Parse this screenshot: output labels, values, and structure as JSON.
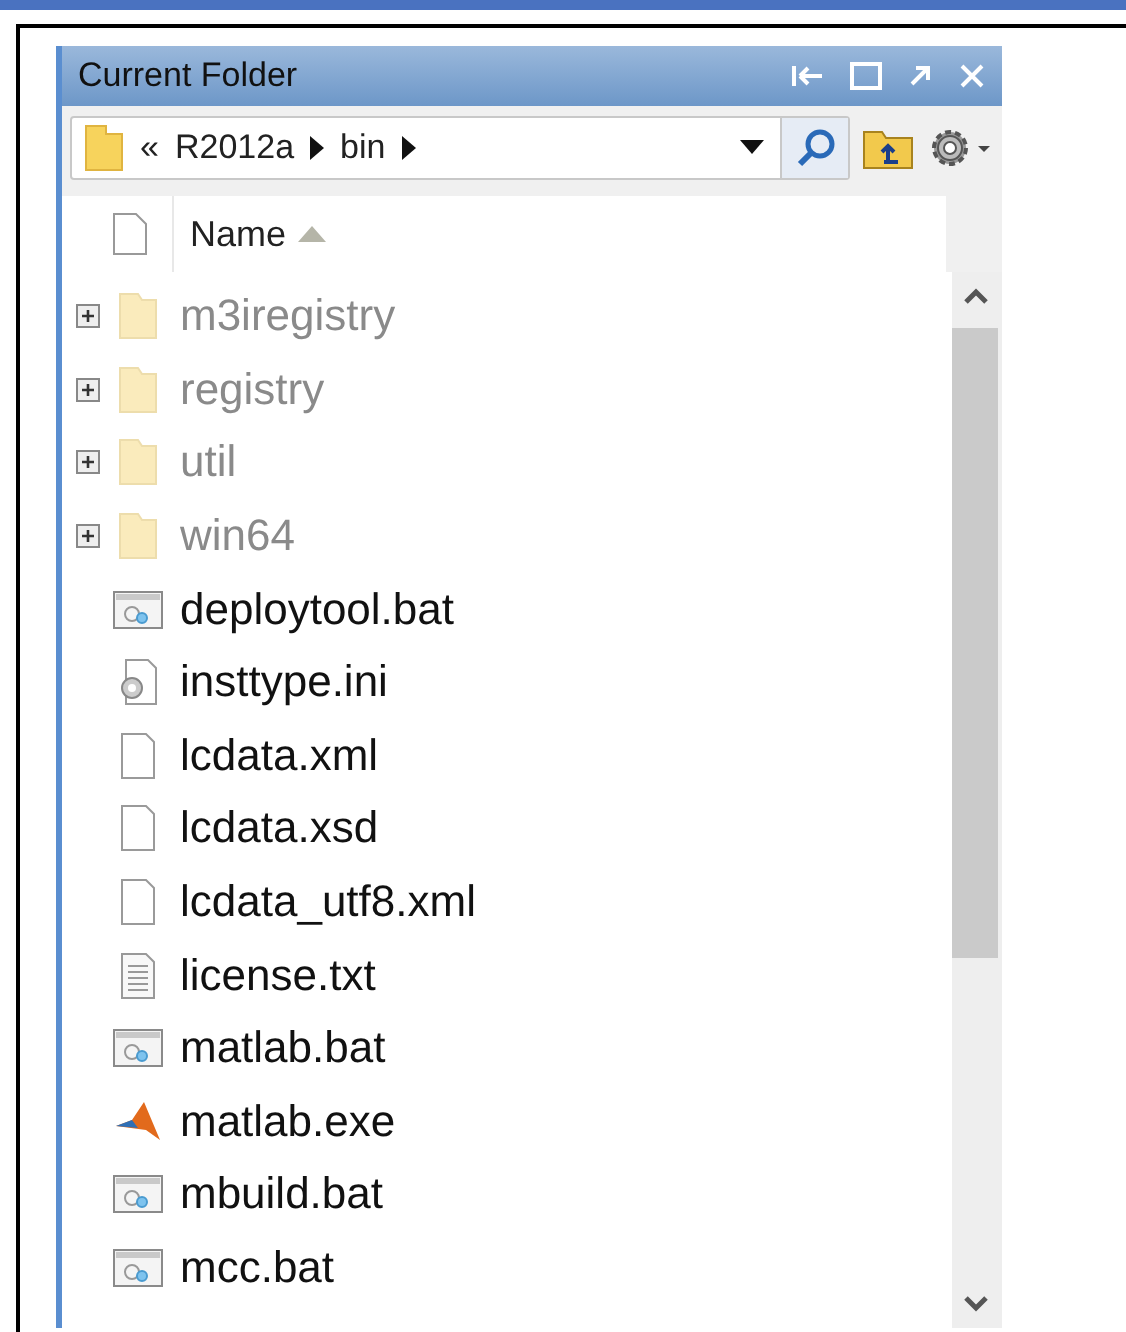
{
  "panel": {
    "title": "Current Folder"
  },
  "address": {
    "crumbs": [
      "«",
      "R2012a",
      "bin"
    ]
  },
  "header": {
    "column": "Name",
    "sorted_ascending": true
  },
  "files": [
    {
      "name": "m3iregistry",
      "kind": "folder",
      "dimmed": true,
      "expanded": false
    },
    {
      "name": "registry",
      "kind": "folder",
      "dimmed": true,
      "expanded": false
    },
    {
      "name": "util",
      "kind": "folder",
      "dimmed": true,
      "expanded": false
    },
    {
      "name": "win64",
      "kind": "folder",
      "dimmed": true,
      "expanded": false
    },
    {
      "name": "deploytool.bat",
      "kind": "bat",
      "dimmed": false
    },
    {
      "name": "insttype.ini",
      "kind": "ini",
      "dimmed": false
    },
    {
      "name": "lcdata.xml",
      "kind": "file",
      "dimmed": false
    },
    {
      "name": "lcdata.xsd",
      "kind": "file",
      "dimmed": false
    },
    {
      "name": "lcdata_utf8.xml",
      "kind": "file",
      "dimmed": false
    },
    {
      "name": "license.txt",
      "kind": "txt",
      "dimmed": false
    },
    {
      "name": "matlab.bat",
      "kind": "bat",
      "dimmed": false
    },
    {
      "name": "matlab.exe",
      "kind": "exe",
      "dimmed": false
    },
    {
      "name": "mbuild.bat",
      "kind": "bat",
      "dimmed": false
    },
    {
      "name": "mcc.bat",
      "kind": "bat",
      "dimmed": false
    }
  ]
}
